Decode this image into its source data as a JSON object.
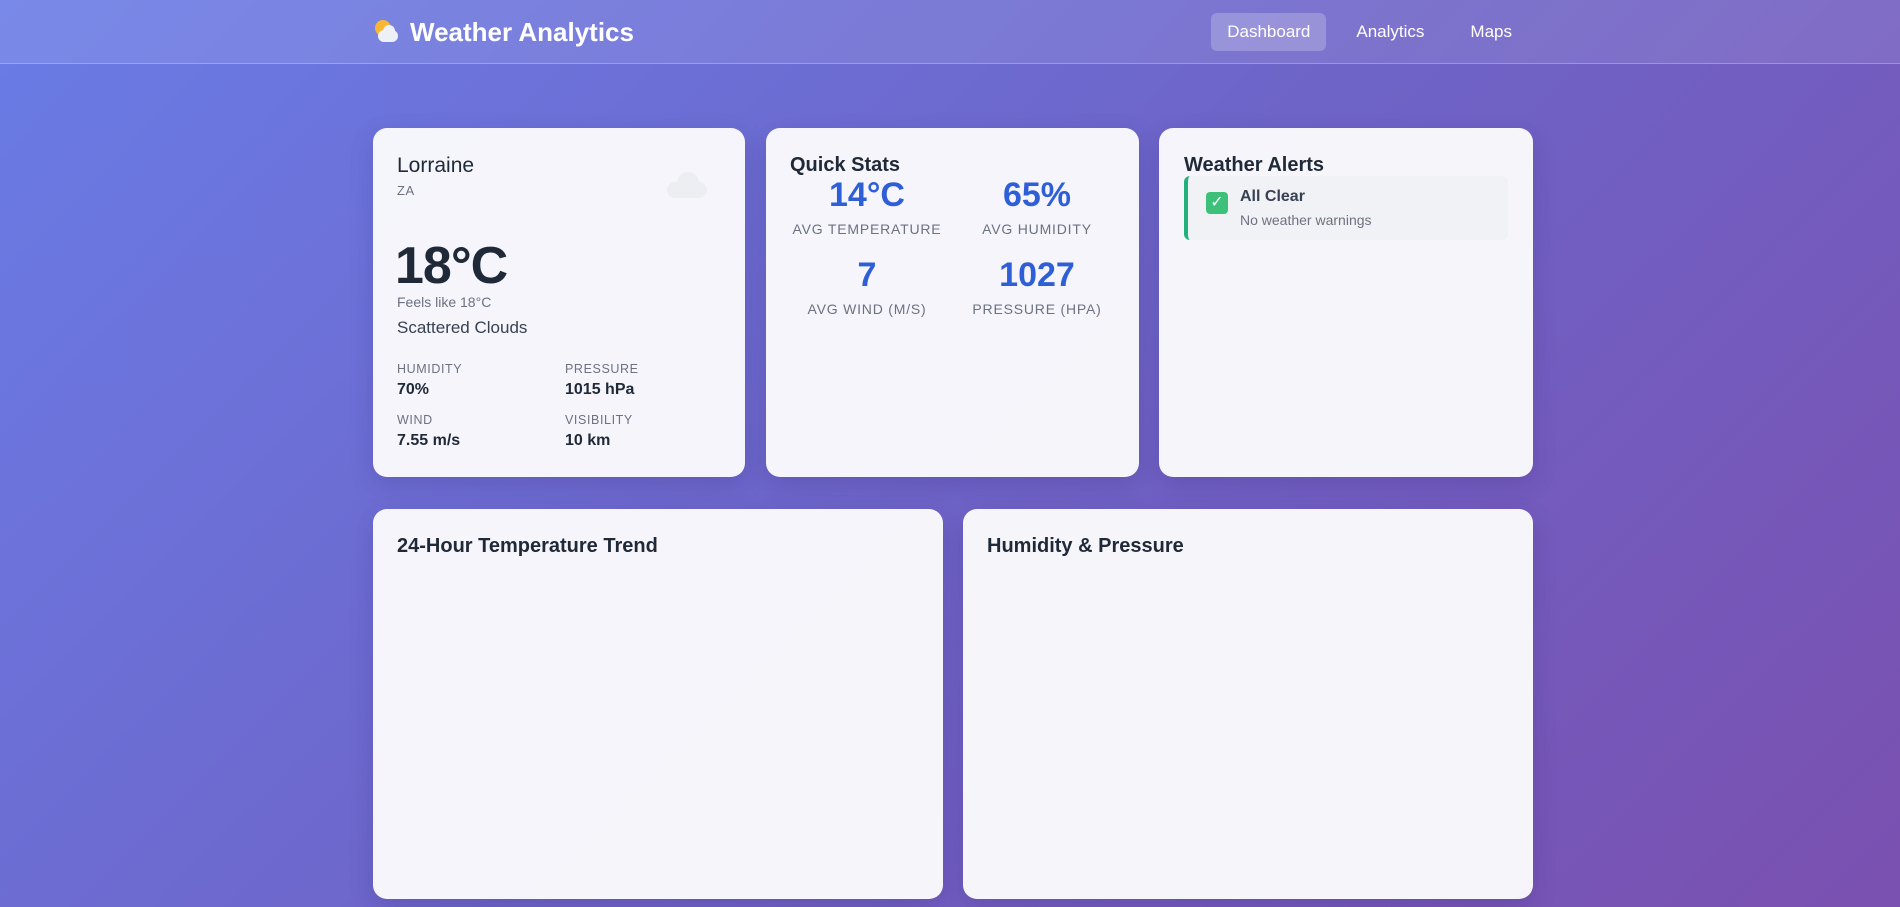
{
  "header": {
    "brand": "Weather Analytics",
    "nav": [
      {
        "label": "Dashboard",
        "active": true
      },
      {
        "label": "Analytics",
        "active": false
      },
      {
        "label": "Maps",
        "active": false
      }
    ]
  },
  "current": {
    "city": "Lorraine",
    "country": "ZA",
    "temperature": "18°C",
    "feels_like": "Feels like 18°C",
    "description": "Scattered Clouds",
    "metrics": {
      "humidity": {
        "label": "HUMIDITY",
        "value": "70%"
      },
      "pressure": {
        "label": "PRESSURE",
        "value": "1015 hPa"
      },
      "wind": {
        "label": "WIND",
        "value": "7.55 m/s"
      },
      "visibility": {
        "label": "VISIBILITY",
        "value": "10 km"
      }
    }
  },
  "stats": {
    "title": "Quick Stats",
    "items": [
      {
        "value": "14°C",
        "label": "AVG TEMPERATURE"
      },
      {
        "value": "65%",
        "label": "AVG HUMIDITY"
      },
      {
        "value": "7",
        "label": "AVG WIND (M/S)"
      },
      {
        "value": "1027",
        "label": "PRESSURE (HPA)"
      }
    ]
  },
  "alerts": {
    "title": "Weather Alerts",
    "items": [
      {
        "title": "All Clear",
        "subtitle": "No weather warnings"
      }
    ]
  },
  "charts": {
    "temperature_title": "24-Hour Temperature Trend",
    "humidity_pressure_title": "Humidity & Pressure"
  },
  "colors": {
    "accent": "#2f5fd6",
    "ok": "#22b07d"
  }
}
